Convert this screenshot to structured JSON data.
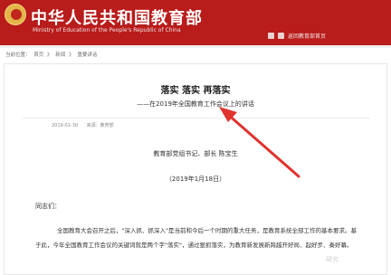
{
  "header": {
    "site_title": "中华人民共和国教育部",
    "site_subtitle": "Ministry of Education of the People's Republic of China",
    "right_link": "返回教育部首页",
    "bg_color": "#b81c1b"
  },
  "breadcrumb": {
    "items": [
      "当前位置：",
      "首页",
      "》",
      "新闻",
      "》",
      "重要讲话"
    ]
  },
  "article": {
    "title": "落实 落实 再落实",
    "subtitle": "——在2019年全国教育工作会议上的讲话",
    "meta": {
      "date": "2019-01-30",
      "source": "来源：教育部"
    },
    "author": "教育部党组书记、部长 陈宝生",
    "date_line": "（2019年1月18日）",
    "greeting": "同志们：",
    "paragraph": "全国教育大会召开之后，\"深入抓、抓深入\"是当前和今后一个时期的重大任务，是教育系统全部工作的基本要求。基于此，今年全国教育工作会议的关键词就是两个字\"落实\"，通过狠抓落实，为教育新发展新跨越开好局、起好步、奏好幕。"
  },
  "annotation": {
    "arrow_color": "#e0332e"
  },
  "watermark": "研究"
}
